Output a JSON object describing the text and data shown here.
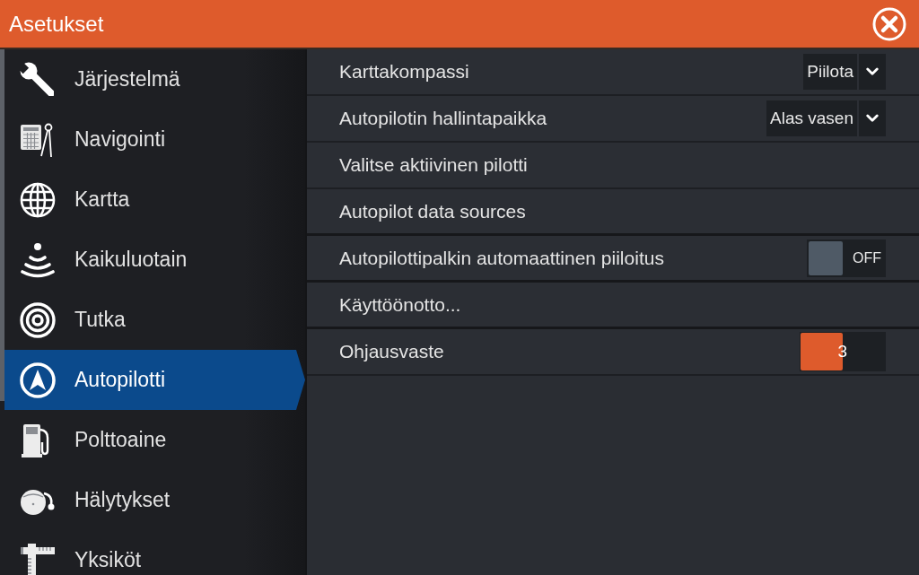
{
  "window": {
    "title": "Asetukset"
  },
  "sidebar": {
    "items": [
      {
        "label": "Järjestelmä",
        "selected": false
      },
      {
        "label": "Navigointi",
        "selected": false
      },
      {
        "label": "Kartta",
        "selected": false
      },
      {
        "label": "Kaikuluotain",
        "selected": false
      },
      {
        "label": "Tutka",
        "selected": false
      },
      {
        "label": "Autopilotti",
        "selected": true
      },
      {
        "label": "Polttoaine",
        "selected": false
      },
      {
        "label": "Hälytykset",
        "selected": false
      },
      {
        "label": "Yksiköt",
        "selected": false
      }
    ]
  },
  "settings": [
    {
      "kind": "dropdown",
      "label": "Karttakompassi",
      "value": "Piilota"
    },
    {
      "kind": "dropdown",
      "label": "Autopilotin hallintapaikka",
      "value": "Alas vasen"
    },
    {
      "kind": "link",
      "label": "Valitse aktiivinen pilotti"
    },
    {
      "kind": "link",
      "label": "Autopilot data sources"
    },
    {
      "kind": "toggle",
      "label": "Autopilottipalkin automaattinen piiloitus",
      "on": false,
      "state_text": "OFF"
    },
    {
      "kind": "link",
      "label": "Käyttöönotto..."
    },
    {
      "kind": "slider",
      "label": "Ohjausvaste",
      "value": "3",
      "level": 0.5
    }
  ]
}
